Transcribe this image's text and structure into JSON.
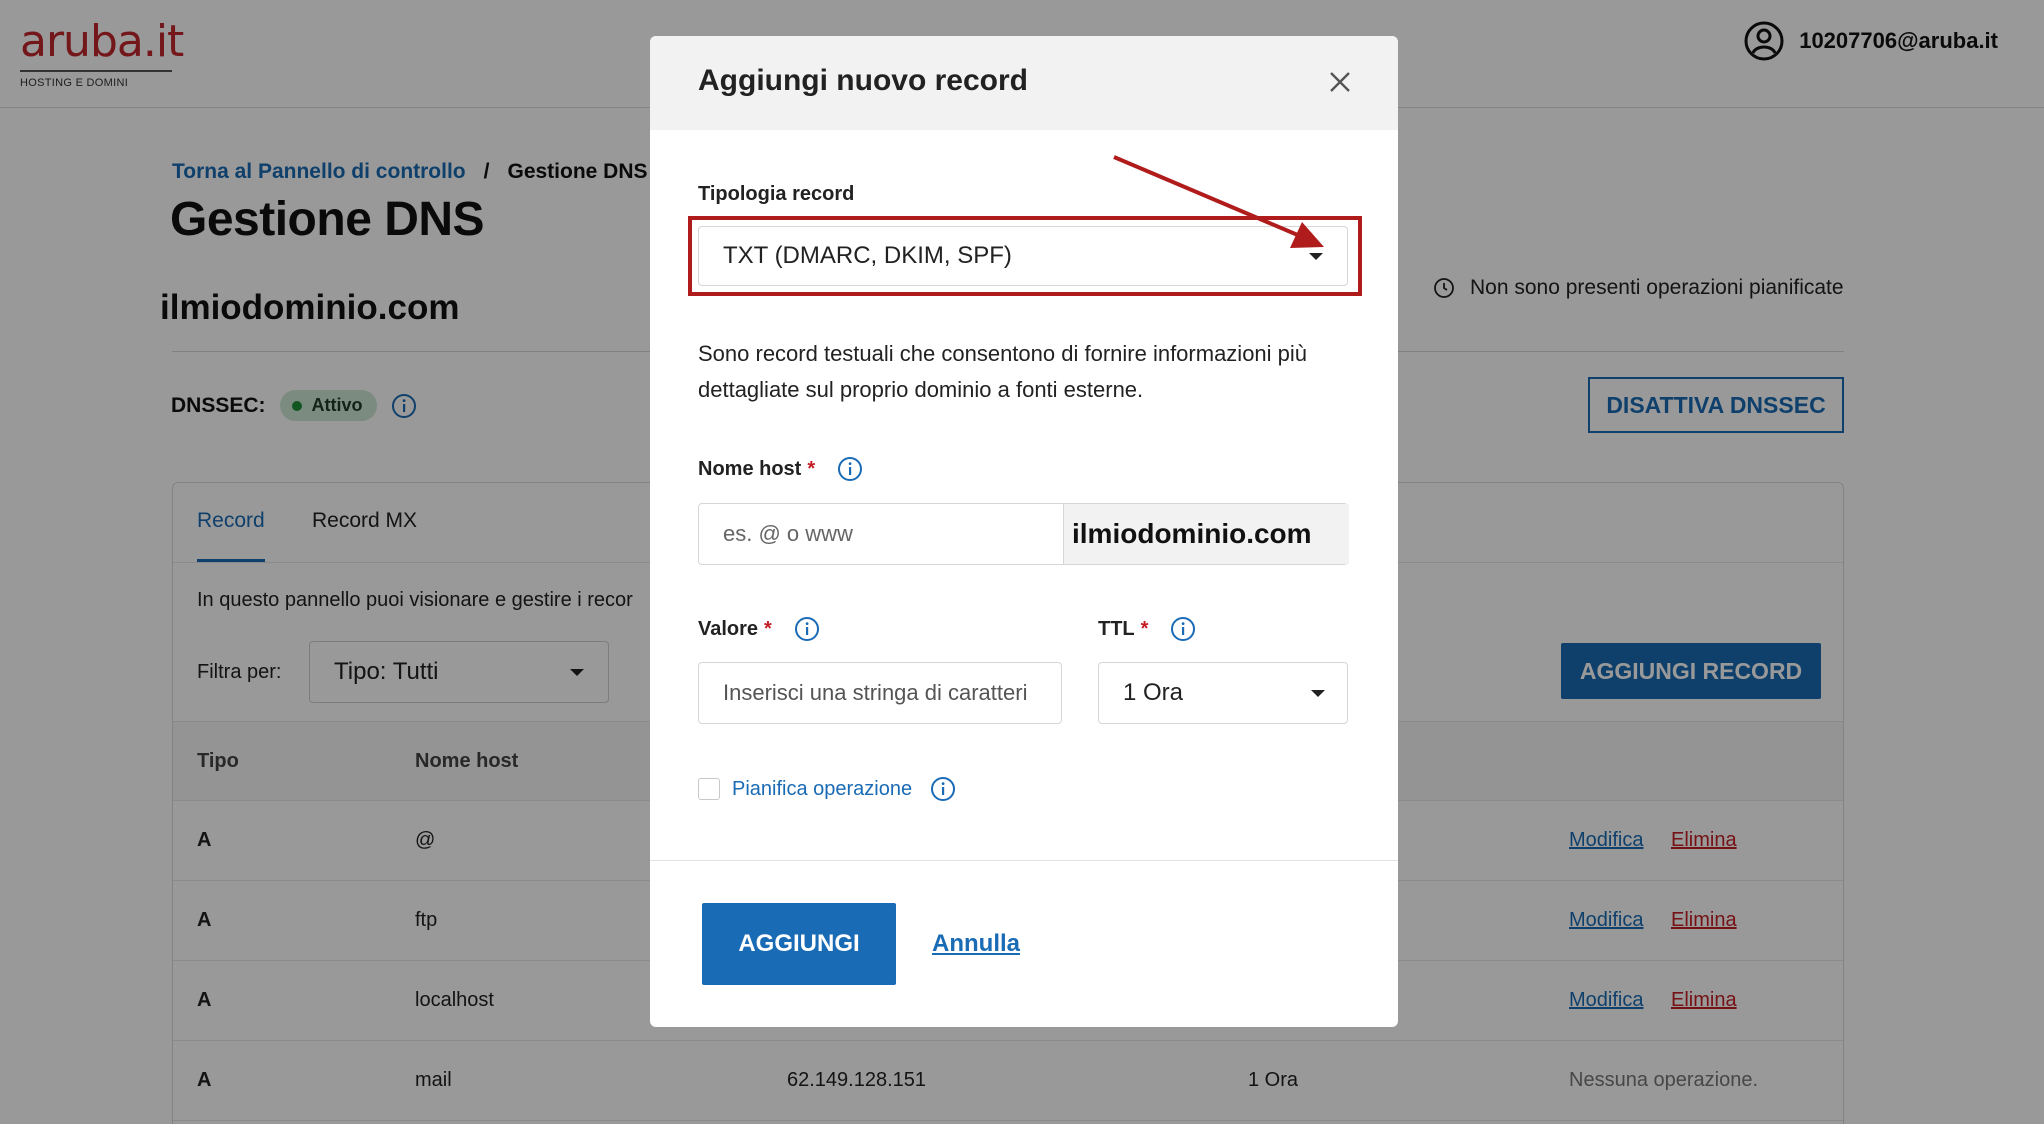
{
  "header": {
    "logo_text": "aruba.it",
    "logo_subtitle": "HOSTING E DOMINI",
    "account_email": "10207706@aruba.it"
  },
  "page": {
    "breadcrumb_back": "Torna al Pannello di controllo",
    "breadcrumb_sep": "/",
    "breadcrumb_current": "Gestione DNS",
    "title": "Gestione DNS",
    "domain": "ilmiodominio.com",
    "schedule_note": "Non sono presenti operazioni pianificate",
    "dnssec_label": "DNSSEC:",
    "dnssec_status": "Attivo",
    "disable_dnssec_label": "DISATTIVA DNSSEC"
  },
  "panel": {
    "tabs": [
      {
        "label": "Record",
        "active": true
      },
      {
        "label": "Record MX",
        "active": false
      }
    ],
    "description": "In questo pannello puoi visionare e gestire i recor",
    "filter_label": "Filtra per:",
    "filter_value": "Tipo: Tutti",
    "add_record_label": "AGGIUNGI RECORD",
    "columns": [
      "Tipo",
      "Nome host"
    ],
    "rows": [
      {
        "type": "A",
        "host": "@",
        "value": "",
        "ttl": "",
        "edit": "Modifica",
        "delete": "Elimina"
      },
      {
        "type": "A",
        "host": "ftp",
        "value": "",
        "ttl": "",
        "edit": "Modifica",
        "delete": "Elimina"
      },
      {
        "type": "A",
        "host": "localhost",
        "value": "",
        "ttl": "",
        "edit": "Modifica",
        "delete": "Elimina"
      },
      {
        "type": "A",
        "host": "mail",
        "value": "62.149.128.151",
        "ttl": "1 Ora",
        "note": "Nessuna operazione."
      }
    ]
  },
  "modal": {
    "title": "Aggiungi nuovo record",
    "record_type_label": "Tipologia record",
    "record_type_value": "TXT (DMARC, DKIM, SPF)",
    "description": "Sono record testuali che consentono di fornire informazioni più dettagliate sul proprio dominio a fonti esterne.",
    "host_label": "Nome host",
    "host_placeholder": "es. @ o www",
    "host_suffix": "ilmiodominio.com",
    "value_label": "Valore",
    "value_placeholder": "Inserisci una stringa di caratteri",
    "ttl_label": "TTL",
    "ttl_value": "1 Ora",
    "schedule_label": "Pianifica operazione",
    "schedule_checked": false,
    "required_mark": "*",
    "submit_label": "AGGIUNGI",
    "cancel_label": "Annulla"
  },
  "colors": {
    "brand_red": "#c1272d",
    "link_blue": "#1a6bb5",
    "danger_red": "#c41e24",
    "annotation_red": "#b01c1c",
    "status_green": "#1f8f3a",
    "overlay": "rgba(0,0,0,0.4)"
  },
  "icons": [
    "user-circle-icon",
    "clock-icon",
    "info-icon",
    "chevron-down-icon",
    "close-icon",
    "annotation-arrow"
  ]
}
